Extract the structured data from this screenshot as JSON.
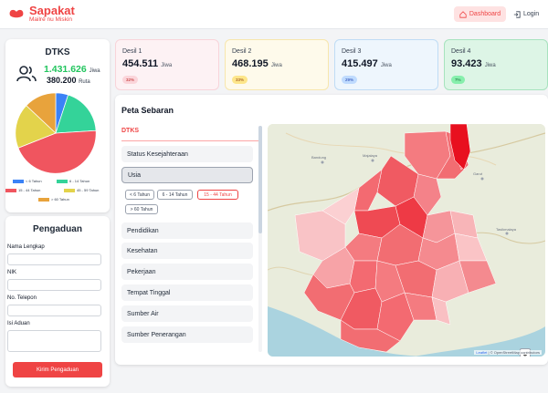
{
  "header": {
    "brand_title": "Sapakat",
    "brand_subtitle": "Mailré nu Miskin",
    "nav_dashboard": "Dashboard",
    "nav_login": "Login",
    "accent_color": "#ef4444"
  },
  "dtks": {
    "title": "DTKS",
    "jiwa_value": "1.431.626",
    "jiwa_unit": "Jiwa",
    "ruta_value": "380.200",
    "ruta_unit": "Ruta"
  },
  "chart_data": {
    "type": "pie",
    "title": "",
    "series": [
      {
        "name": "< 6 Tahun",
        "value": 5,
        "color": "#3b82f6"
      },
      {
        "name": "6 - 14 Tahun",
        "value": 19,
        "color": "#34d399"
      },
      {
        "name": "15 - 44 Tahun",
        "value": 45,
        "color": "#f0555f"
      },
      {
        "name": "45 - 59 Tahun",
        "value": 18,
        "color": "#e3d34b"
      },
      {
        "name": "> 60 Tahun",
        "value": 13,
        "color": "#e8a33c"
      }
    ],
    "legend_placement": "bottom"
  },
  "pengaduan": {
    "title": "Pengaduan",
    "fields": [
      {
        "label": "Nama Lengkap",
        "value": ""
      },
      {
        "label": "NIK",
        "value": ""
      },
      {
        "label": "No. Telepon",
        "value": ""
      },
      {
        "label": "Isi Aduan",
        "value": ""
      }
    ],
    "submit_label": "Kirim Pengaduan"
  },
  "desil": [
    {
      "label": "Desil 1",
      "value": "454.511",
      "unit": "Jiwa",
      "pct": "32%",
      "bg": "#fdf2f4",
      "border": "#f8d4da",
      "pill_bg": "#fbd5da",
      "pill_fg": "#b91c1c"
    },
    {
      "label": "Desil 2",
      "value": "468.195",
      "unit": "Jiwa",
      "pct": "33%",
      "bg": "#fefaeb",
      "border": "#f7e6ad",
      "pill_bg": "#fde68a",
      "pill_fg": "#92400e"
    },
    {
      "label": "Desil 3",
      "value": "415.497",
      "unit": "Jiwa",
      "pct": "29%",
      "bg": "#eef6fd",
      "border": "#bfdcf5",
      "pill_bg": "#bfdbfe",
      "pill_fg": "#1e40af"
    },
    {
      "label": "Desil 4",
      "value": "93.423",
      "unit": "Jiwa",
      "pct": "7%",
      "bg": "#ddf5e6",
      "border": "#a7e3be",
      "pill_bg": "#86efac",
      "pill_fg": "#166534"
    }
  ],
  "peta": {
    "title": "Peta Sebaran",
    "tab": "DTKS",
    "categories": [
      "Status Kesejahteraan",
      "Usia",
      "Pendidikan",
      "Kesehatan",
      "Pekerjaan",
      "Tempat Tinggal",
      "Sumber Air",
      "Sumber Penerangan"
    ],
    "selected_category": "Usia",
    "age_filters": [
      "< 6 Tahun",
      "6 - 14 Tahun",
      "15 - 44 Tahun",
      "> 60 Tahun"
    ],
    "selected_filter": "15 - 44 Tahun",
    "map_labels": [
      "Bandung",
      "Majalaya",
      "Garut",
      "Tasikmalaya"
    ],
    "zoom_in": "+",
    "zoom_out": "−",
    "attribution_leaflet": "Leaflet",
    "attribution_osm": "© OpenStreetMap contributors"
  }
}
